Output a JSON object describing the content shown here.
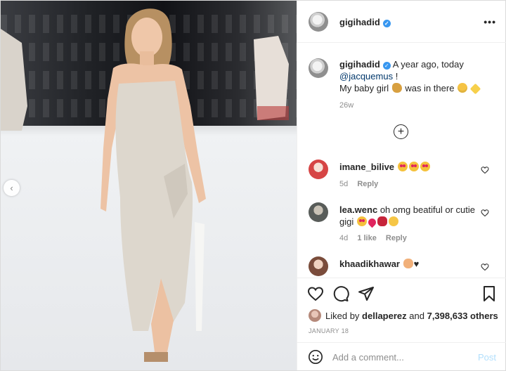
{
  "post": {
    "username": "gigihadid",
    "verified_icon": "verified-badge-icon",
    "more_icon": "more-options-icon"
  },
  "caption": {
    "username": "gigihadid",
    "text_before": "A year ago, today",
    "mention": "@jacquemus",
    "text_after": "!",
    "line2": "My baby girl",
    "line2_after": "was in there",
    "time": "26w"
  },
  "comments": [
    {
      "username": "imane_bilive",
      "text": "",
      "time": "5d",
      "likes": "",
      "reply": "Reply"
    },
    {
      "username": "lea.wenc",
      "text": "oh omg beatiful or cutie gigi",
      "time": "4d",
      "likes": "1 like",
      "reply": "Reply"
    },
    {
      "username": "khaadikhawar",
      "text": "",
      "time": "",
      "likes": "",
      "reply": ""
    }
  ],
  "actions": {
    "liked_by_prefix": "Liked by",
    "liked_by_user": "dellaperez",
    "liked_by_and": "and",
    "liked_by_count": "7,398,633 others",
    "date": "January 18"
  },
  "add_comment": {
    "placeholder": "Add a comment...",
    "post_label": "Post"
  },
  "colors": {
    "link": "#00376b",
    "verified": "#3897f0",
    "post_disabled": "#b2dffc",
    "muted": "#8e8e8e"
  }
}
